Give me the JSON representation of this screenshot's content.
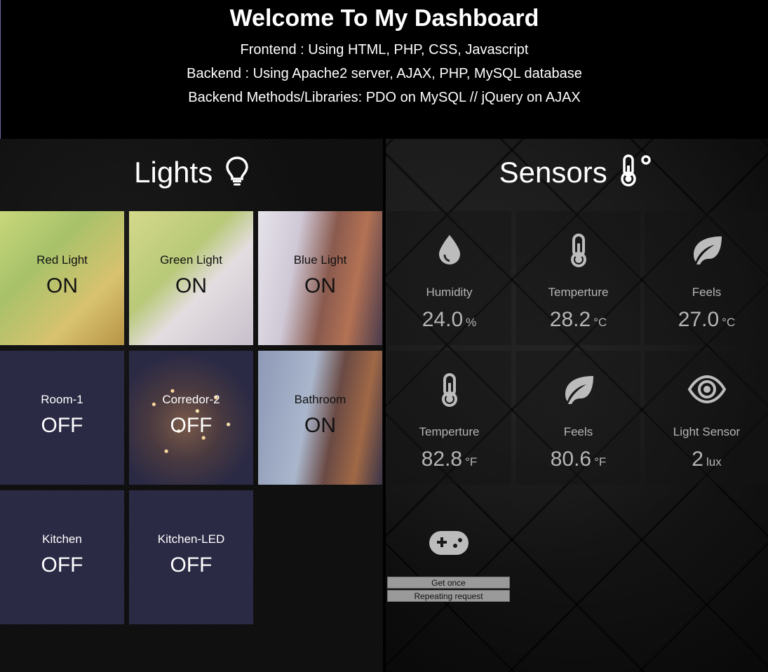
{
  "header": {
    "title": "Welcome To My Dashboard",
    "line1": "Frontend : Using HTML, PHP, CSS, Javascript",
    "line2": "Backend : Using Apache2 server, AJAX, PHP, MySQL database",
    "line3": "Backend Methods/Libraries: PDO on MySQL // jQuery on AJAX"
  },
  "lights": {
    "title": "Lights",
    "icon": "lightbulb-icon",
    "items": [
      {
        "name": "Red Light",
        "state": "ON"
      },
      {
        "name": "Green Light",
        "state": "ON"
      },
      {
        "name": "Blue Light",
        "state": "ON"
      },
      {
        "name": "Room-1",
        "state": "OFF"
      },
      {
        "name": "Corredor-2",
        "state": "OFF"
      },
      {
        "name": "Bathroom",
        "state": "ON"
      },
      {
        "name": "Kitchen",
        "state": "OFF"
      },
      {
        "name": "Kitchen-LED",
        "state": "OFF"
      }
    ]
  },
  "sensors": {
    "title": "Sensors",
    "icon": "thermometer-degree-icon",
    "items": [
      {
        "label": "Humidity",
        "value": "24.0",
        "unit": "%",
        "icon": "droplet-icon"
      },
      {
        "label": "Temperture",
        "value": "28.2",
        "unit": "°C",
        "icon": "thermometer-icon"
      },
      {
        "label": "Feels",
        "value": "27.0",
        "unit": "°C",
        "icon": "leaf-icon"
      },
      {
        "label": "Temperture",
        "value": "82.8",
        "unit": "°F",
        "icon": "thermometer-icon"
      },
      {
        "label": "Feels",
        "value": "80.6",
        "unit": "°F",
        "icon": "leaf-icon"
      },
      {
        "label": "Light Sensor",
        "value": "2",
        "unit": "lux",
        "icon": "eye-icon"
      }
    ],
    "controls": {
      "icon": "gamepad-icon",
      "get_once": "Get once",
      "repeating": "Repeating request"
    }
  }
}
